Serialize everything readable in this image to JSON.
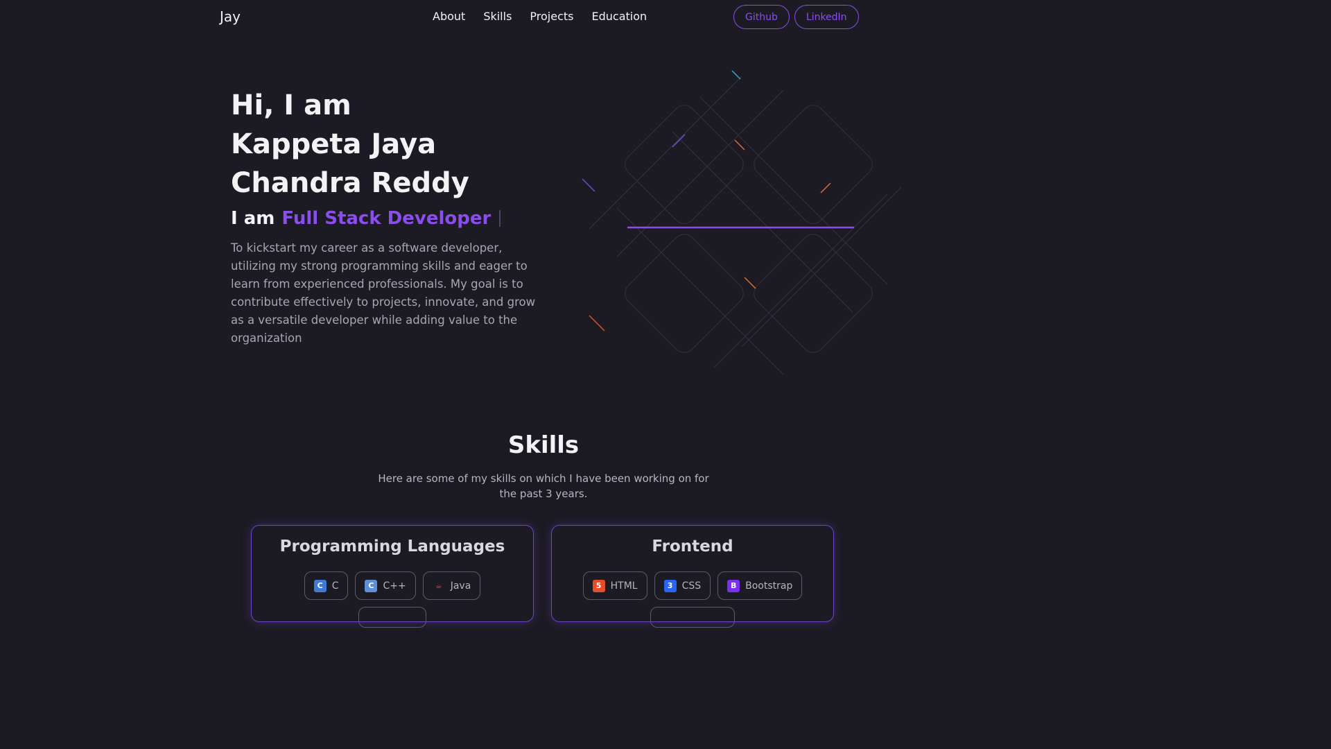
{
  "nav": {
    "brand": "Jay",
    "links": [
      "About",
      "Skills",
      "Projects",
      "Education"
    ],
    "buttons": [
      "Github",
      "LinkedIn"
    ]
  },
  "hero": {
    "title_lines": [
      "Hi, I am",
      "Kappeta Jaya",
      "Chandra Reddy"
    ],
    "role_prefix": "I am",
    "role": "Full Stack Developer",
    "intro": "To kickstart my career as a software developer, utilizing my strong programming skills and eager to learn from experienced professionals. My goal is to contribute effectively to projects, innovate, and grow as a versatile developer while adding value to the organization"
  },
  "skills": {
    "title": "Skills",
    "subtitle": "Here are some of my skills on which I have been working on for the past 3 years.",
    "cards": [
      {
        "title": "Programming Languages",
        "items": [
          {
            "label": "C",
            "icon": "c-logo-icon",
            "color": "#3c7bd6"
          },
          {
            "label": "C++",
            "icon": "cpp-logo-icon",
            "color": "#5f8fd6"
          },
          {
            "label": "Java",
            "icon": "java-logo-icon",
            "color": "#e0412f"
          }
        ]
      },
      {
        "title": "Frontend",
        "items": [
          {
            "label": "HTML",
            "icon": "html5-icon",
            "color": "#e44d26"
          },
          {
            "label": "CSS",
            "icon": "css3-icon",
            "color": "#2965f1"
          },
          {
            "label": "Bootstrap",
            "icon": "bootstrap-icon",
            "color": "#7b2ff2"
          }
        ]
      }
    ]
  },
  "colors": {
    "accent": "#8a4dee",
    "background": "#1c1b23",
    "text": "#f2f3f4",
    "muted_text": "#a8a6b2"
  }
}
